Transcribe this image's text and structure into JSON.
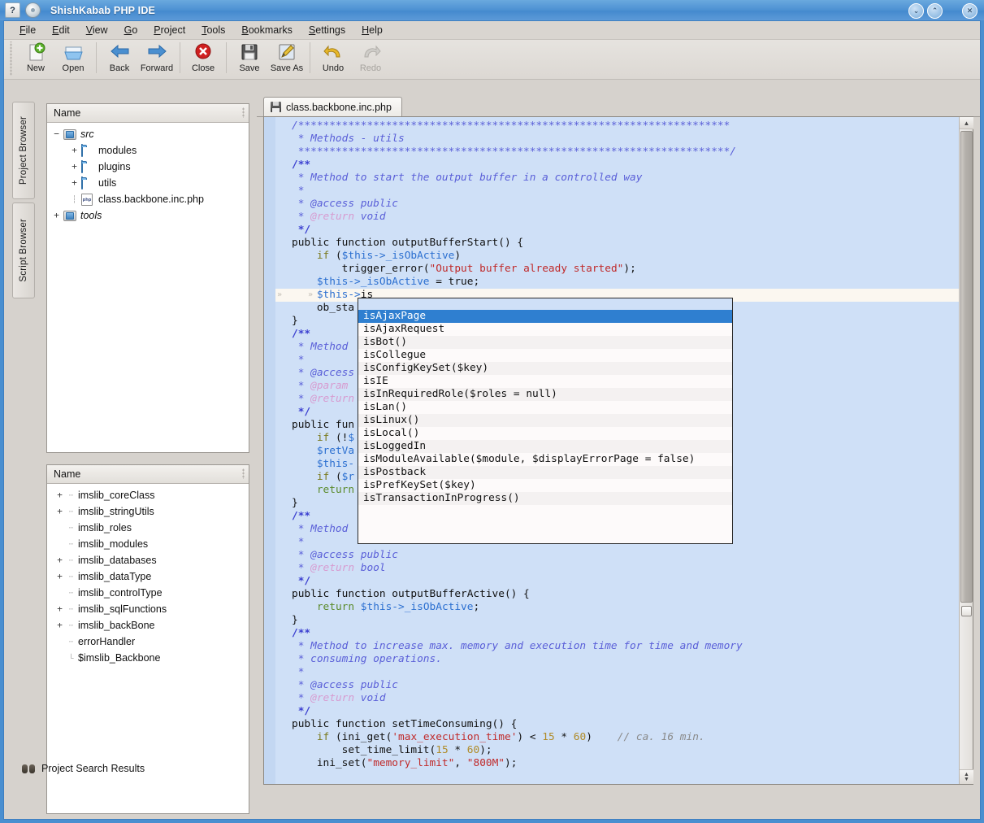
{
  "window": {
    "title": "ShishKabab PHP IDE",
    "controls": [
      {
        "name": "minimize",
        "glyph": "⌄"
      },
      {
        "name": "maximize",
        "glyph": "⌃"
      },
      {
        "name": "close",
        "glyph": "✕"
      }
    ],
    "help_icon": "?"
  },
  "menubar": [
    {
      "label": "File",
      "accel": "F"
    },
    {
      "label": "Edit",
      "accel": "E"
    },
    {
      "label": "View",
      "accel": "V"
    },
    {
      "label": "Go",
      "accel": "G"
    },
    {
      "label": "Project",
      "accel": "P"
    },
    {
      "label": "Tools",
      "accel": "T"
    },
    {
      "label": "Bookmarks",
      "accel": "B"
    },
    {
      "label": "Settings",
      "accel": "S"
    },
    {
      "label": "Help",
      "accel": "H"
    }
  ],
  "toolbar": [
    {
      "label": "New",
      "icon": "new-document-icon",
      "disabled": false
    },
    {
      "label": "Open",
      "icon": "open-folder-icon",
      "disabled": false
    },
    {
      "sep": true
    },
    {
      "label": "Back",
      "icon": "arrow-left-icon",
      "disabled": false
    },
    {
      "label": "Forward",
      "icon": "arrow-right-icon",
      "disabled": false
    },
    {
      "sep": true
    },
    {
      "label": "Close",
      "icon": "close-circle-icon",
      "disabled": false
    },
    {
      "sep": true
    },
    {
      "label": "Save",
      "icon": "floppy-disk-icon",
      "disabled": false
    },
    {
      "label": "Save As",
      "icon": "floppy-pencil-icon",
      "disabled": false
    },
    {
      "sep": true
    },
    {
      "label": "Undo",
      "icon": "undo-arrow-icon",
      "disabled": false
    },
    {
      "label": "Redo",
      "icon": "redo-arrow-icon",
      "disabled": true
    }
  ],
  "side_tabs": [
    {
      "label": "Project Browser"
    },
    {
      "label": "Script Browser"
    }
  ],
  "project_panel": {
    "header": "Name",
    "rows": [
      {
        "indent": 0,
        "exp": "−",
        "icon": "folder-gray",
        "label": "src",
        "italic": true
      },
      {
        "indent": 1,
        "exp": "+",
        "icon": "folder-blue",
        "label": "modules",
        "italic": false
      },
      {
        "indent": 1,
        "exp": "+",
        "icon": "folder-blue",
        "label": "plugins",
        "italic": false
      },
      {
        "indent": 1,
        "exp": "+",
        "icon": "folder-blue",
        "label": "utils",
        "italic": false
      },
      {
        "indent": 1,
        "exp": "",
        "icon": "php-file",
        "label": "class.backbone.inc.php",
        "italic": false
      },
      {
        "indent": 0,
        "exp": "+",
        "icon": "folder-gray",
        "label": "tools",
        "italic": true
      }
    ]
  },
  "script_panel": {
    "header": "Name",
    "rows": [
      {
        "exp": "+",
        "label": "imslib_coreClass"
      },
      {
        "exp": "+",
        "label": "imslib_stringUtils"
      },
      {
        "exp": "",
        "label": "imslib_roles"
      },
      {
        "exp": "",
        "label": "imslib_modules"
      },
      {
        "exp": "+",
        "label": "imslib_databases"
      },
      {
        "exp": "+",
        "label": "imslib_dataType"
      },
      {
        "exp": "",
        "label": "imslib_controlType"
      },
      {
        "exp": "+",
        "label": "imslib_sqlFunctions"
      },
      {
        "exp": "+",
        "label": "imslib_backBone"
      },
      {
        "exp": "",
        "label": "errorHandler"
      },
      {
        "exp": "",
        "label": "$imslib_Backbone"
      }
    ]
  },
  "editor": {
    "tab_label": "class.backbone.inc.php",
    "tab_icon": "floppy-disk-icon"
  },
  "autocomplete": {
    "selected_index": 0,
    "items": [
      "isAjaxPage",
      "isAjaxRequest",
      "isBot()",
      "isCollegue",
      "isConfigKeySet($key)",
      "isIE",
      "isInRequiredRole($roles = null)",
      "isLan()",
      "isLinux()",
      "isLocal()",
      "isLoggedIn",
      "isModuleAvailable($module, $displayErrorPage = false)",
      "isPostback",
      "isPrefKeySet($key)",
      "isTransactionInProgress()"
    ]
  },
  "statusbar": {
    "label": "Project Search Results",
    "icon": "binoculars-icon"
  },
  "colors": {
    "titlebar": "#4a8fd0",
    "editor_bg": "#cfe0f7",
    "current_line": "#fbf7f0",
    "selection": "#2f7fd0",
    "comment": "#5a5fd8",
    "string": "#c02a2a",
    "variable": "#2b6fd0",
    "keyword": "#7a7a1e",
    "number": "#b08b28",
    "return": "#5a8a2a",
    "docblock_tag": "#d79bd0"
  }
}
